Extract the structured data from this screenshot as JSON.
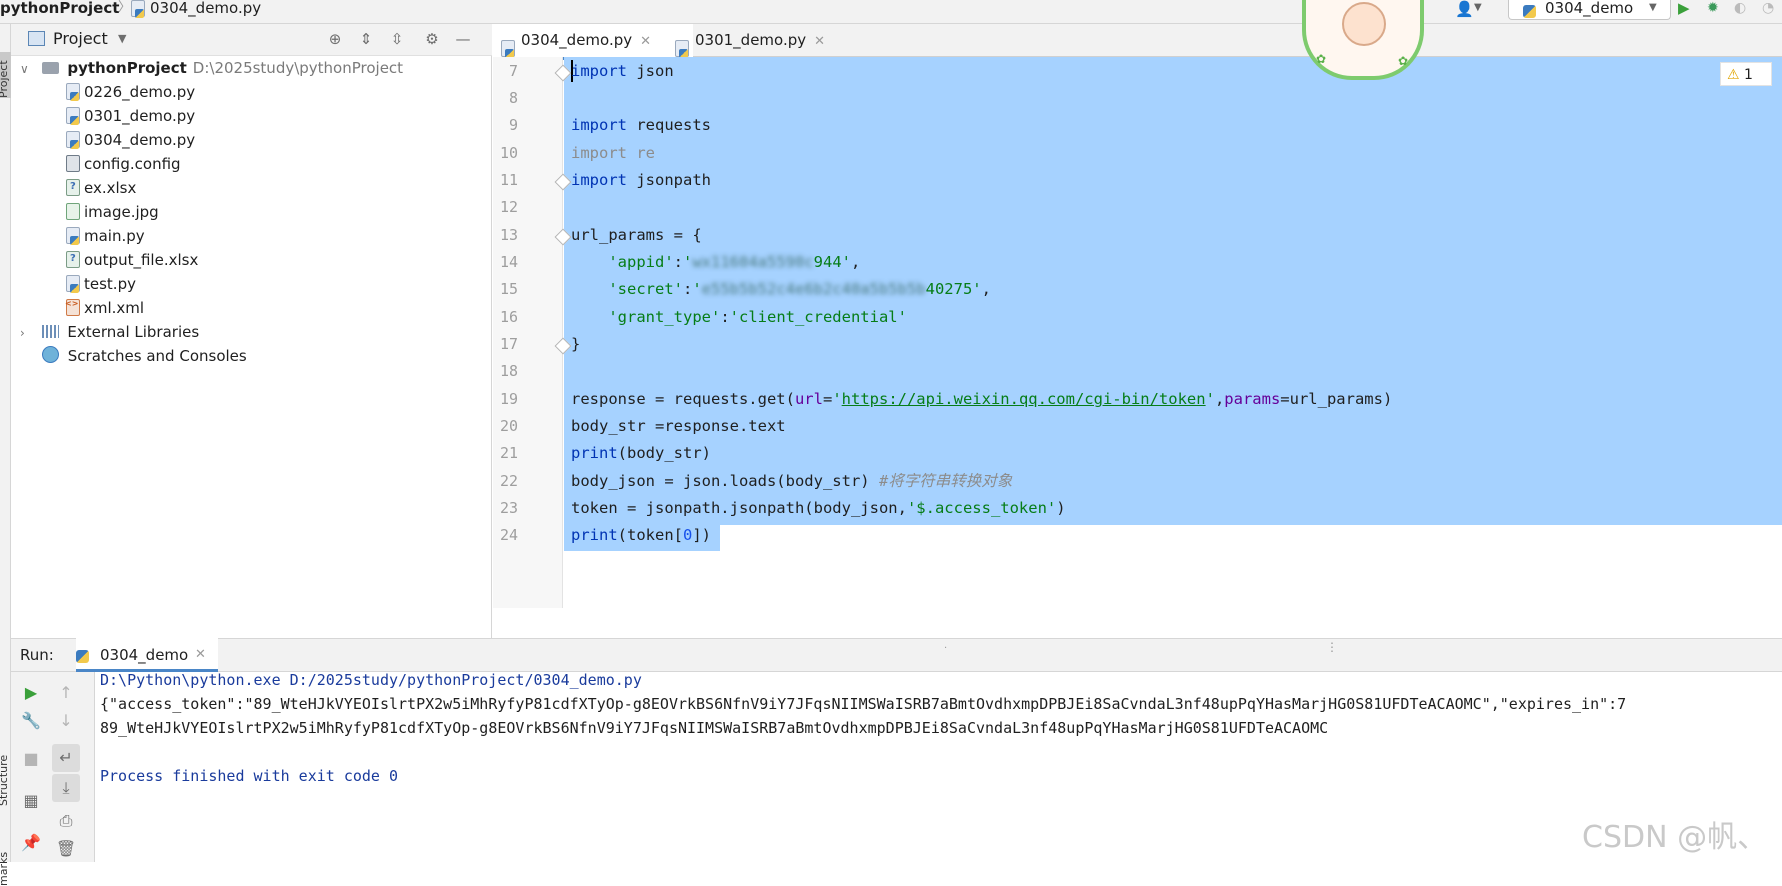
{
  "breadcrumb": {
    "project": "pythonProject",
    "sep": "〉",
    "file": "0304_demo.py"
  },
  "toolbar": {
    "run_config": "0304_demo"
  },
  "side_stripe": {
    "project_label": "Project",
    "structure_label": "Structure",
    "bookmarks_label": "marks"
  },
  "project_panel": {
    "title": "Project",
    "root": {
      "name": "pythonProject",
      "path": "D:\\2025study\\pythonProject"
    },
    "files": [
      "0226_demo.py",
      "0301_demo.py",
      "0304_demo.py",
      "config.config",
      "ex.xlsx",
      "image.jpg",
      "main.py",
      "output_file.xlsx",
      "test.py",
      "xml.xml"
    ],
    "external_libraries": "External Libraries",
    "scratches": "Scratches and Consoles"
  },
  "editor": {
    "tabs": [
      {
        "label": "0304_demo.py",
        "active": true
      },
      {
        "label": "0301_demo.py",
        "active": false
      }
    ],
    "line_numbers": [
      "7",
      "8",
      "9",
      "10",
      "11",
      "12",
      "13",
      "14",
      "15",
      "16",
      "17",
      "18",
      "19",
      "20",
      "21",
      "22",
      "23",
      "24"
    ],
    "warning_count": "1",
    "code": {
      "l7_kw": "import",
      "l7_rest": " json",
      "l9_kw": "import",
      "l9_rest": " requests",
      "l10": "import re",
      "l11_kw": "import",
      "l11_rest": " jsonpath",
      "l13": "url_params = {",
      "l14_key": "'appid'",
      "l14_colon": ":",
      "l14_q1": "'",
      "l14_blur": "wx11604a5590c",
      "l14_tail": "944'",
      "l14_end": ",",
      "l15_key": "'secret'",
      "l15_colon": ":",
      "l15_q1": "'",
      "l15_blur": "e55b5b52c4e6b2c40a5b5b5b",
      "l15_tail": "40275'",
      "l15_end": ",",
      "l16_key": "'grant_type'",
      "l16_colon": ":",
      "l16_val": "'client_credential'",
      "l17": "}",
      "l19_a": "response = requests.get(",
      "l19_p1": "url",
      "l19_eq": "=",
      "l19_q": "'",
      "l19_url": "https://api.weixin.qq.com/cgi-bin/token",
      "l19_q2": "'",
      "l19_comma": ",",
      "l19_p2": "params",
      "l19_b": "=url_params)",
      "l20": "body_str =response.text",
      "l21_fn": "print",
      "l21_rest": "(body_str)",
      "l22_a": "body_json = json.loads(body_str) ",
      "l22_cmt": "#将字符串转换对象",
      "l23_a": "token = jsonpath.jsonpath(body_json,",
      "l23_str": "'$.access_token'",
      "l23_b": ")",
      "l24_fn": "print",
      "l24_a": "(token[",
      "l24_num": "0",
      "l24_b": "])"
    }
  },
  "run": {
    "label": "Run:",
    "tab": "0304_demo",
    "console": [
      "D:\\Python\\python.exe D:/2025study/pythonProject/0304_demo.py",
      "{\"access_token\":\"89_WteHJkVYEOIslrtPX2w5iMhRyfyP81cdfXTyOp-g8EOVrkBS6NfnV9iY7JFqsNIIMSWaISRB7aBmtOvdhxmpDPBJEi8SaCvndaL3nf48upPqYHasMarjHG0S81UFDTeACAOMC\",\"expires_in\":7",
      "89_WteHJkVYEOIslrtPX2w5iMhRyfyP81cdfXTyOp-g8EOVrkBS6NfnV9iY7JFqsNIIMSWaISRB7aBmtOvdhxmpDPBJEi8SaCvndaL3nf48upPqYHasMarjHG0S81UFDTeACAOMC",
      "",
      "Process finished with exit code 0"
    ]
  },
  "watermark": "CSDN @帆、",
  "colors": {
    "selection": "#a6d2ff",
    "keyword": "#0033b3",
    "string": "#067d17",
    "console_blue": "#1a3b9c"
  }
}
